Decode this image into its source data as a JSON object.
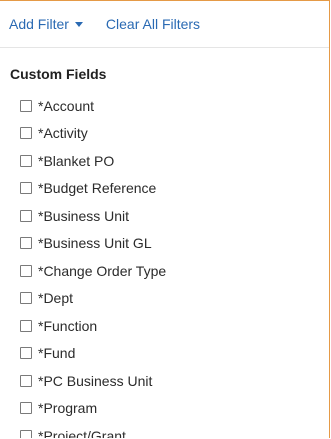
{
  "toolbar": {
    "add_filter_label": "Add Filter",
    "clear_all_label": "Clear All Filters"
  },
  "custom_fields": {
    "title": "Custom Fields",
    "items": [
      {
        "label": "*Account"
      },
      {
        "label": "*Activity"
      },
      {
        "label": "*Blanket PO"
      },
      {
        "label": "*Budget Reference"
      },
      {
        "label": "*Business Unit"
      },
      {
        "label": "*Business Unit GL"
      },
      {
        "label": "*Change Order Type"
      },
      {
        "label": "*Dept"
      },
      {
        "label": "*Function"
      },
      {
        "label": "*Fund"
      },
      {
        "label": "*PC Business Unit"
      },
      {
        "label": "*Program"
      },
      {
        "label": "*Project/Grant"
      }
    ]
  },
  "colors": {
    "link": "#2a6ab3",
    "panel_border": "#e59a46"
  }
}
